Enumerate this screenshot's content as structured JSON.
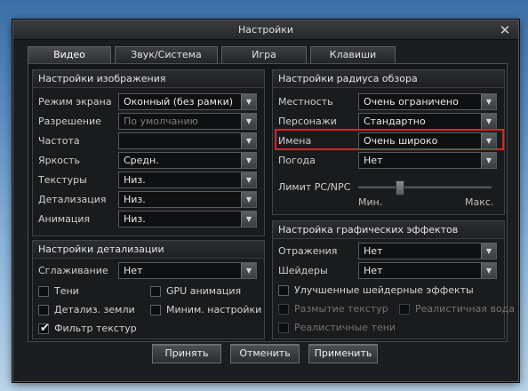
{
  "window": {
    "title": "Настройки"
  },
  "tabs": [
    {
      "label": "Видео"
    },
    {
      "label": "Звук/Система"
    },
    {
      "label": "Игра"
    },
    {
      "label": "Клавиши"
    }
  ],
  "image_settings": {
    "header": "Настройки изображения",
    "rows": [
      {
        "label": "Режим экрана",
        "value": "Оконный (без рамки)"
      },
      {
        "label": "Разрешение",
        "value": "По умолчанию"
      },
      {
        "label": "Частота",
        "value": ""
      },
      {
        "label": "Яркость",
        "value": "Средн."
      },
      {
        "label": "Текстуры",
        "value": "Низ."
      },
      {
        "label": "Детализация",
        "value": "Низ."
      },
      {
        "label": "Анимация",
        "value": "Низ."
      }
    ]
  },
  "view_radius": {
    "header": "Настройки радиуса обзора",
    "rows": [
      {
        "label": "Местность",
        "value": "Очень ограничено"
      },
      {
        "label": "Персонажи",
        "value": "Стандартно"
      },
      {
        "label": "Имена",
        "value": "Очень широко"
      },
      {
        "label": "Погода",
        "value": "Нет"
      }
    ],
    "pc_npc_limit": {
      "label": "Лимит PC/NPC",
      "min_label": "Мин.",
      "max_label": "Макс.",
      "level": 0.3
    }
  },
  "detail_settings": {
    "header": "Настройки детализации",
    "antialiasing": {
      "label": "Сглаживание",
      "value": "Нет"
    },
    "checks": [
      {
        "label": "Тени",
        "checked": ""
      },
      {
        "label": "GPU анимация",
        "checked": ""
      },
      {
        "label": "Детализ. земли",
        "checked": ""
      },
      {
        "label": "Миним. настройки",
        "checked": ""
      },
      {
        "label": "Фильтр текстур",
        "checked": "✔"
      }
    ]
  },
  "graphic_effects": {
    "header": "Настройка графических эффектов",
    "reflections": {
      "label": "Отражения",
      "value": "Нет"
    },
    "shaders": {
      "label": "Шейдеры",
      "value": "Нет"
    },
    "checks": [
      {
        "label": "Улучшенные шейдерные эффекты",
        "checked": ""
      },
      {
        "label": "Размытие текстур",
        "checked": ""
      },
      {
        "label": "Реалистичная вода",
        "checked": ""
      },
      {
        "label": "Реалистичные тени",
        "checked": ""
      }
    ]
  },
  "buttons": {
    "accept": "Принять",
    "cancel": "Отменить",
    "apply": "Применить"
  },
  "icons": {
    "close": "close-icon",
    "dropdown": "chevron-down-icon",
    "check": "checkmark-icon"
  },
  "colors": {
    "highlight": "#d9232b"
  }
}
